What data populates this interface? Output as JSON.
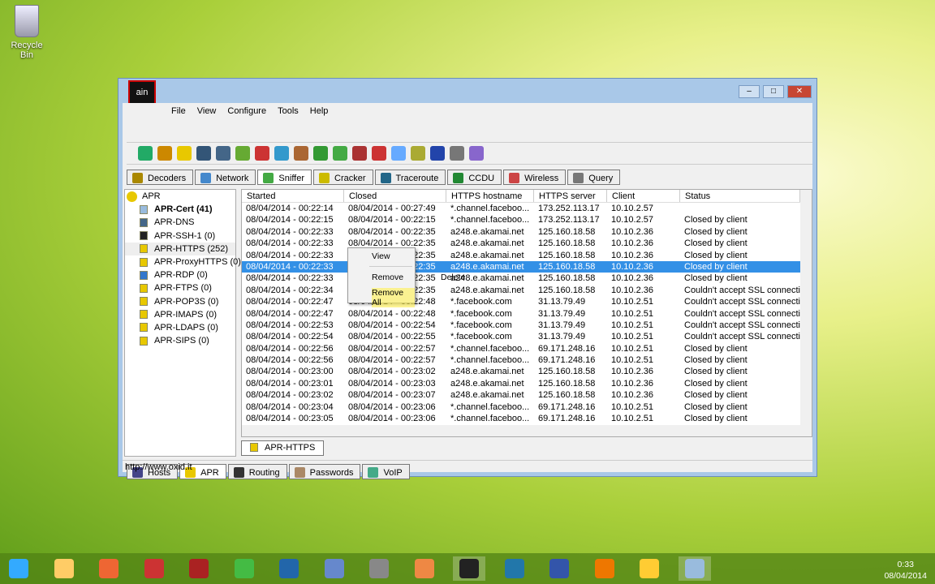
{
  "desktop": {
    "recycle_bin": "Recycle Bin"
  },
  "app": {
    "logo": "ain",
    "menu": [
      "File",
      "View",
      "Configure",
      "Tools",
      "Help"
    ],
    "tabs": [
      "Decoders",
      "Network",
      "Sniffer",
      "Cracker",
      "Traceroute",
      "CCDU",
      "Wireless",
      "Query"
    ],
    "tree": {
      "root": "APR",
      "items": [
        "APR-Cert (41)",
        "APR-DNS",
        "APR-SSH-1 (0)",
        "APR-HTTPS (252)",
        "APR-ProxyHTTPS (0)",
        "APR-RDP (0)",
        "APR-FTPS (0)",
        "APR-POP3S (0)",
        "APR-IMAPS (0)",
        "APR-LDAPS (0)",
        "APR-SIPS (0)"
      ]
    },
    "columns": [
      "Started",
      "Closed",
      "HTTPS hostname",
      "HTTPS server",
      "Client",
      "Status"
    ],
    "rows": [
      [
        "08/04/2014 - 00:22:14",
        "08/04/2014 - 00:27:49",
        "*.channel.faceboo...",
        "173.252.113.17",
        "10.10.2.57",
        ""
      ],
      [
        "08/04/2014 - 00:22:15",
        "08/04/2014 - 00:22:15",
        "*.channel.faceboo...",
        "173.252.113.17",
        "10.10.2.57",
        "Closed by client"
      ],
      [
        "08/04/2014 - 00:22:33",
        "08/04/2014 - 00:22:35",
        "a248.e.akamai.net",
        "125.160.18.58",
        "10.10.2.36",
        "Closed by client"
      ],
      [
        "08/04/2014 - 00:22:33",
        "08/04/2014 - 00:22:35",
        "a248.e.akamai.net",
        "125.160.18.58",
        "10.10.2.36",
        "Closed by client"
      ],
      [
        "08/04/2014 - 00:22:33",
        "08/04/2014 - 00:22:35",
        "a248.e.akamai.net",
        "125.160.18.58",
        "10.10.2.36",
        "Closed by client"
      ],
      [
        "08/04/2014 - 00:22:33",
        "08/04/2014 - 00:22:35",
        "a248.e.akamai.net",
        "125.160.18.58",
        "10.10.2.36",
        "Closed by client"
      ],
      [
        "08/04/2014 - 00:22:33",
        "08/04/2014 - 00:22:35",
        "a248.e.akamai.net",
        "125.160.18.58",
        "10.10.2.36",
        "Closed by client"
      ],
      [
        "08/04/2014 - 00:22:34",
        "08/04/2014 - 00:22:35",
        "a248.e.akamai.net",
        "125.160.18.58",
        "10.10.2.36",
        "Couldn't accept SSL connectic"
      ],
      [
        "08/04/2014 - 00:22:47",
        "08/04/2014 - 00:22:48",
        "*.facebook.com",
        "31.13.79.49",
        "10.10.2.51",
        "Couldn't accept SSL connectic"
      ],
      [
        "08/04/2014 - 00:22:47",
        "08/04/2014 - 00:22:48",
        "*.facebook.com",
        "31.13.79.49",
        "10.10.2.51",
        "Couldn't accept SSL connectic"
      ],
      [
        "08/04/2014 - 00:22:53",
        "08/04/2014 - 00:22:54",
        "*.facebook.com",
        "31.13.79.49",
        "10.10.2.51",
        "Couldn't accept SSL connectic"
      ],
      [
        "08/04/2014 - 00:22:54",
        "08/04/2014 - 00:22:55",
        "*.facebook.com",
        "31.13.79.49",
        "10.10.2.51",
        "Couldn't accept SSL connectic"
      ],
      [
        "08/04/2014 - 00:22:56",
        "08/04/2014 - 00:22:57",
        "*.channel.faceboo...",
        "69.171.248.16",
        "10.10.2.51",
        "Closed by client"
      ],
      [
        "08/04/2014 - 00:22:56",
        "08/04/2014 - 00:22:57",
        "*.channel.faceboo...",
        "69.171.248.16",
        "10.10.2.51",
        "Closed by client"
      ],
      [
        "08/04/2014 - 00:23:00",
        "08/04/2014 - 00:23:02",
        "a248.e.akamai.net",
        "125.160.18.58",
        "10.10.2.36",
        "Closed by client"
      ],
      [
        "08/04/2014 - 00:23:01",
        "08/04/2014 - 00:23:03",
        "a248.e.akamai.net",
        "125.160.18.58",
        "10.10.2.36",
        "Closed by client"
      ],
      [
        "08/04/2014 - 00:23:02",
        "08/04/2014 - 00:23:07",
        "a248.e.akamai.net",
        "125.160.18.58",
        "10.10.2.36",
        "Closed by client"
      ],
      [
        "08/04/2014 - 00:23:04",
        "08/04/2014 - 00:23:06",
        "*.channel.faceboo...",
        "69.171.248.16",
        "10.10.2.51",
        "Closed by client"
      ],
      [
        "08/04/2014 - 00:23:05",
        "08/04/2014 - 00:23:06",
        "*.channel.faceboo...",
        "69.171.248.16",
        "10.10.2.51",
        "Closed by client"
      ]
    ],
    "selected_row": 5,
    "context_menu": {
      "view": "View",
      "remove": "Remove",
      "remove_shortcut": "Delete",
      "remove_all": "Remove All"
    },
    "subtab": "APR-HTTPS",
    "bottom_tabs": [
      "Hosts",
      "APR",
      "Routing",
      "Passwords",
      "VoIP"
    ],
    "status": "http://www.oxid.it"
  },
  "clock": {
    "time": "0:33",
    "date": "08/04/2014"
  }
}
